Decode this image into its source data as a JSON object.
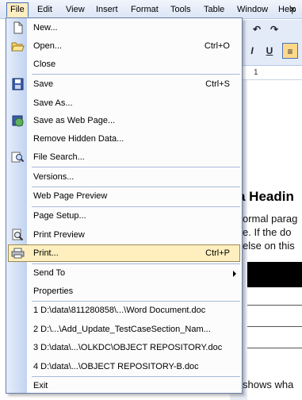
{
  "menubar": {
    "items": [
      "File",
      "Edit",
      "View",
      "Insert",
      "Format",
      "Tools",
      "Table",
      "Window",
      "Help"
    ],
    "close_glyph": "×"
  },
  "document": {
    "heading_fragment": "a Headin",
    "line1": "ormal parag",
    "line2": "e. If the do",
    "line3": "else on this",
    "line4": "shows wha",
    "ruler_mark": "1"
  },
  "file_menu": {
    "new": {
      "label": "New...",
      "icon": "new-document-icon"
    },
    "open": {
      "label": "Open...",
      "shortcut": "Ctrl+O",
      "icon": "open-folder-icon"
    },
    "close": {
      "label": "Close"
    },
    "save": {
      "label": "Save",
      "shortcut": "Ctrl+S",
      "icon": "save-disk-icon"
    },
    "save_as": {
      "label": "Save As..."
    },
    "save_web": {
      "label": "Save as Web Page...",
      "icon": "web-page-icon"
    },
    "remove_hidden": {
      "label": "Remove Hidden Data..."
    },
    "file_search": {
      "label": "File Search...",
      "icon": "search-icon"
    },
    "versions": {
      "label": "Versions..."
    },
    "web_preview": {
      "label": "Web Page Preview"
    },
    "page_setup": {
      "label": "Page Setup..."
    },
    "print_preview": {
      "label": "Print Preview",
      "icon": "print-preview-icon"
    },
    "print": {
      "label": "Print...",
      "shortcut": "Ctrl+P",
      "icon": "printer-icon"
    },
    "send_to": {
      "label": "Send To"
    },
    "properties": {
      "label": "Properties"
    },
    "recent": [
      "1 D:\\data\\811280858\\...\\Word Document.doc",
      "2 D:\\...\\Add_Update_TestCaseSection_Nam...",
      "3 D:\\data\\...\\OLKDC\\OBJECT REPOSITORY.doc",
      "4 D:\\data\\...\\OBJECT REPOSITORY-B.doc"
    ],
    "exit": {
      "label": "Exit"
    }
  },
  "colors": {
    "highlight": "#ffefbf",
    "gutter": "#c2d3f0",
    "menubar": "#dbe5f6"
  }
}
